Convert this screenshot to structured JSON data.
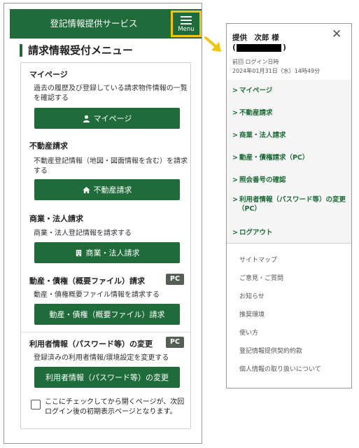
{
  "header": {
    "title": "登記情報提供サービス",
    "menu_label": "Menu"
  },
  "page_heading": "請求情報受付メニュー",
  "sections": [
    {
      "title": "マイページ",
      "desc": "過去の履歴及び登録している請求物件情報の一覧を確認する",
      "button": "マイページ",
      "icon": "person-icon"
    },
    {
      "title": "不動産請求",
      "desc": "不動産登記情報（地図・図面情報を含む）を請求する",
      "button": "不動産請求",
      "icon": "house-icon"
    },
    {
      "title": "商業・法人請求",
      "desc": "商業・法人登記情報を請求する",
      "button": "商業・法人請求",
      "icon": "building-icon"
    },
    {
      "title": "動産・債権（概要ファイル）請求",
      "desc": "動産・債権概要ファイル情報を請求する",
      "button": "動産・債権（概要ファイル）請求",
      "badge": "PC"
    },
    {
      "title": "利用者情報（パスワード等）の変更",
      "desc": "登録済みの利用者情報/環境設定を変更する",
      "button": "利用者情報（パスワード等）の変更",
      "badge": "PC"
    }
  ],
  "checkbox_text": "ここにチェックしてから開くページが、次回ログイン後の初期表示ページとなります。",
  "side_menu": {
    "user_name": "提供　次郎 様",
    "user_paren_open": "(",
    "user_paren_close": ")",
    "last_login_label": "前回 ログイン日時",
    "last_login_value": "2024年01月31日（水）14時49分",
    "nav_items": [
      "マイページ",
      "不動産請求",
      "商業・法人請求",
      "動産・債権請求（PC）",
      "照会番号の確認",
      "利用者情報（パスワード等）の変更（PC）",
      "ログアウト"
    ],
    "sub_links": [
      "サイトマップ",
      "ご意見・ご質問",
      "お知らせ",
      "推奨環境",
      "使い方",
      "登記情報提供契約約款",
      "個人情報の取り扱いについて"
    ]
  },
  "colors": {
    "brand_green": "#1f6b3a",
    "highlight_yellow": "#f1c40f",
    "badge_gray": "#555f55"
  }
}
